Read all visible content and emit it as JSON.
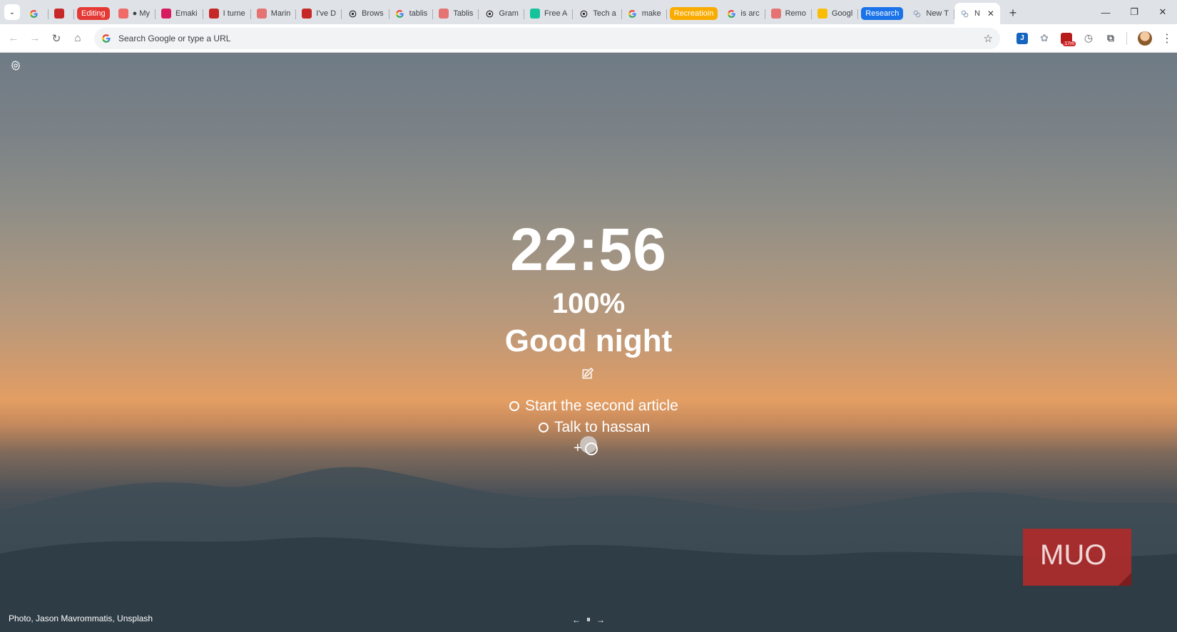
{
  "tabstrip": {
    "tabs": [
      {
        "label": "",
        "favicon": "google-icon",
        "color": "#ffffff"
      },
      {
        "label": "",
        "favicon": "muo-icon",
        "color": "#c62828"
      },
      {
        "label": "Editing",
        "group": true,
        "color": "#e53935"
      },
      {
        "label": "● My",
        "favicon": "asana-icon",
        "color": "#f06a6a"
      },
      {
        "label": "Emaki",
        "favicon": "emaki-icon",
        "color": "#d81b60"
      },
      {
        "label": "I turne",
        "favicon": "muo-icon",
        "color": "#c62828"
      },
      {
        "label": "Marin",
        "favicon": "marin-icon",
        "color": "#e57373"
      },
      {
        "label": "I've D",
        "favicon": "muo-icon",
        "color": "#c62828"
      },
      {
        "label": "Brows",
        "favicon": "openai-icon",
        "color": "#222222"
      },
      {
        "label": "tablis",
        "favicon": "google-icon",
        "color": "#ffffff"
      },
      {
        "label": "Tablis",
        "favicon": "tablis-icon",
        "color": "#e57373"
      },
      {
        "label": "Gram",
        "favicon": "openai-icon",
        "color": "#222222"
      },
      {
        "label": "Free A",
        "favicon": "grammarly-icon",
        "color": "#15c39a"
      },
      {
        "label": "Tech a",
        "favicon": "openai-icon",
        "color": "#222222"
      },
      {
        "label": "make",
        "favicon": "google-icon",
        "color": "#ffffff"
      },
      {
        "label": "Recreatioin",
        "group": true,
        "color": "#f9ab00"
      },
      {
        "label": "is arc",
        "favicon": "google-icon",
        "color": "#ffffff"
      },
      {
        "label": "Remo",
        "favicon": "remo-icon",
        "color": "#e57373"
      },
      {
        "label": "Googl",
        "favicon": "keep-icon",
        "color": "#fbbc04"
      },
      {
        "label": "Research",
        "group": true,
        "color": "#1a73e8"
      },
      {
        "label": "New T",
        "favicon": "tablis-logo-icon",
        "color": "#9ab"
      },
      {
        "label": "N",
        "favicon": "tablis-logo-icon",
        "color": "#9ab",
        "active": true
      }
    ],
    "new_tab": "+",
    "window": {
      "minimize": "—",
      "restore": "❐",
      "close": "✕"
    }
  },
  "toolbar": {
    "back": "←",
    "forward": "→",
    "reload": "↻",
    "home": "⌂",
    "omnibox_placeholder": "Search Google or type a URL",
    "bookmark": "☆",
    "extensions": [
      {
        "name": "translate-extension-icon",
        "glyph": "J",
        "color": "#1565c0"
      },
      {
        "name": "tablis-extension-icon",
        "glyph": "✿",
        "color": "#9aa6b2"
      },
      {
        "name": "timer-extension-icon",
        "glyph": "",
        "color": "#b71c1c",
        "badge": "17m"
      },
      {
        "name": "history-extension-icon",
        "glyph": "◷",
        "color": "#5f6368"
      },
      {
        "name": "puzzle-extension-icon",
        "glyph": "⧉",
        "color": "#5f6368"
      }
    ],
    "menu": "⋮"
  },
  "page": {
    "clock": "22:56",
    "battery": "100%",
    "greeting": "Good night",
    "todos": [
      {
        "text": "Start the second article",
        "done": false
      },
      {
        "text": "Talk to hassan",
        "done": false
      }
    ],
    "add_symbol": "+",
    "photo_credit": "Photo, Jason Mavrommatis, Unsplash",
    "bg_nav": {
      "prev": "←",
      "pause": "⏸",
      "next": "→"
    },
    "watermark": "MUO"
  }
}
